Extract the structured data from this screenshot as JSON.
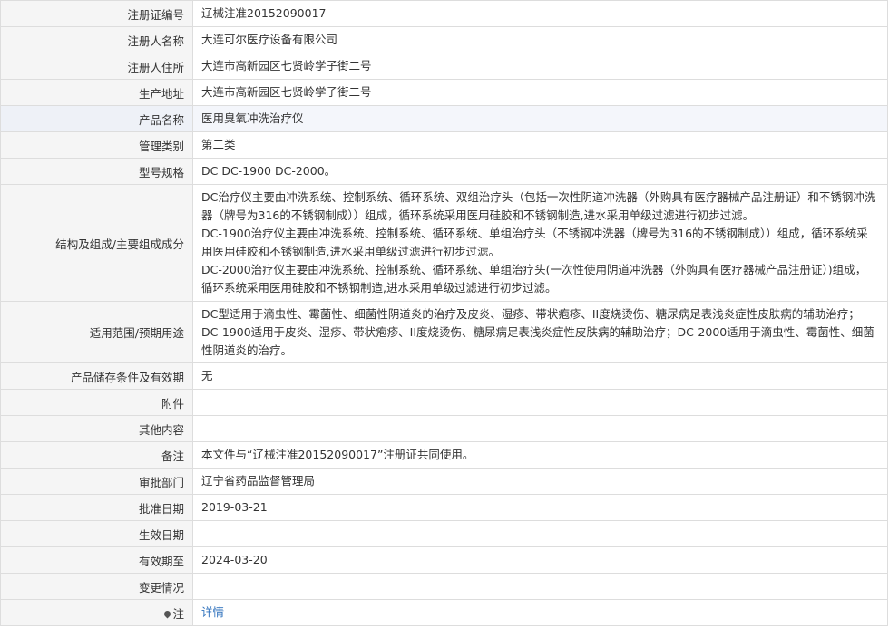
{
  "rows": [
    {
      "label": "注册证编号",
      "value": "辽械注准20152090017"
    },
    {
      "label": "注册人名称",
      "value": "大连可尔医疗设备有限公司"
    },
    {
      "label": "注册人住所",
      "value": "大连市高新园区七贤岭学子街二号"
    },
    {
      "label": "生产地址",
      "value": "大连市高新园区七贤岭学子街二号"
    },
    {
      "label": "产品名称",
      "value": "医用臭氧冲洗治疗仪"
    },
    {
      "label": "管理类别",
      "value": "第二类"
    },
    {
      "label": "型号规格",
      "value": "DC DC-1900 DC-2000。"
    },
    {
      "label": "结构及组成/主要组成成分",
      "paragraphs": [
        "DC治疗仪主要由冲洗系统、控制系统、循环系统、双组治疗头（包括一次性阴道冲洗器（外购具有医疗器械产品注册证）和不锈钢冲洗器（牌号为316的不锈钢制成））组成，循环系统采用医用硅胶和不锈钢制造,进水采用单级过滤进行初步过滤。",
        "DC-1900治疗仪主要由冲洗系统、控制系统、循环系统、单组治疗头（不锈钢冲洗器（牌号为316的不锈钢制成））组成，循环系统采用医用硅胶和不锈钢制造,进水采用单级过滤进行初步过滤。",
        "DC-2000治疗仪主要由冲洗系统、控制系统、循环系统、单组治疗头(一次性使用阴道冲洗器（外购具有医疗器械产品注册证）)组成，循环系统采用医用硅胶和不锈钢制造,进水采用单级过滤进行初步过滤。"
      ]
    },
    {
      "label": "适用范围/预期用途",
      "value": "DC型适用于滴虫性、霉菌性、细菌性阴道炎的治疗及皮炎、湿疹、带状疱疹、II度烧烫伤、糖尿病足表浅炎症性皮肤病的辅助治疗；DC-1900适用于皮炎、湿疹、带状疱疹、II度烧烫伤、糖尿病足表浅炎症性皮肤病的辅助治疗；DC-2000适用于滴虫性、霉菌性、细菌性阴道炎的治疗。"
    },
    {
      "label": "产品储存条件及有效期",
      "value": "无"
    },
    {
      "label": "附件",
      "value": ""
    },
    {
      "label": "其他内容",
      "value": ""
    },
    {
      "label": "备注",
      "value": "本文件与“辽械注准20152090017”注册证共同使用。"
    },
    {
      "label": "审批部门",
      "value": "辽宁省药品监督管理局"
    },
    {
      "label": "批准日期",
      "value": "2019-03-21"
    },
    {
      "label": "生效日期",
      "value": ""
    },
    {
      "label": "有效期至",
      "value": "2024-03-20"
    },
    {
      "label": "变更情况",
      "value": ""
    }
  ],
  "note": {
    "icon": "location-pin-icon",
    "label": "注",
    "link_text": "详情",
    "link_color": "#2a6ebb"
  }
}
